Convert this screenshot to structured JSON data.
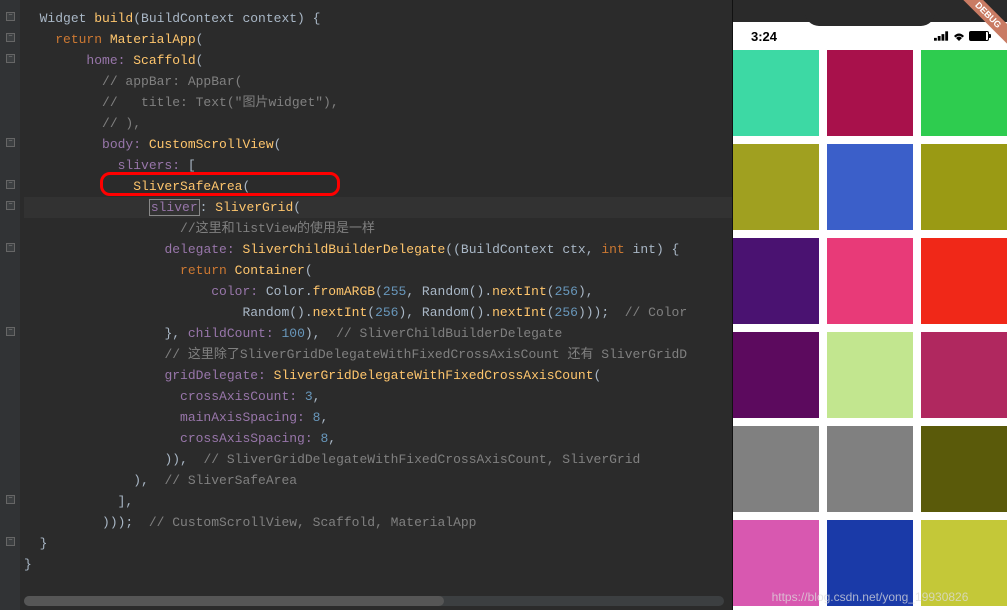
{
  "editor": {
    "lines": [
      {
        "indent": 1,
        "tokens": [
          [
            "Widget ",
            "type"
          ],
          [
            "build",
            "build"
          ],
          [
            "(BuildContext context) {",
            "punc"
          ]
        ]
      },
      {
        "indent": 2,
        "tokens": [
          [
            "return ",
            "return"
          ],
          [
            "MaterialApp",
            "widget"
          ],
          [
            "(",
            "punc"
          ]
        ]
      },
      {
        "indent": 4,
        "tokens": [
          [
            "home: ",
            "prop"
          ],
          [
            "Scaffold",
            "widget"
          ],
          [
            "(",
            "punc"
          ]
        ]
      },
      {
        "indent": 5,
        "tokens": [
          [
            "// appBar: AppBar(",
            "comment"
          ]
        ]
      },
      {
        "indent": 5,
        "tokens": [
          [
            "//   title: Text(\"图片widget\"),",
            "comment"
          ]
        ]
      },
      {
        "indent": 5,
        "tokens": [
          [
            "// ),",
            "comment"
          ]
        ]
      },
      {
        "indent": 5,
        "tokens": [
          [
            "body: ",
            "prop"
          ],
          [
            "CustomScrollView",
            "widget"
          ],
          [
            "(",
            "punc"
          ]
        ]
      },
      {
        "indent": 6,
        "tokens": [
          [
            "slivers: ",
            "prop"
          ],
          [
            "[",
            "punc"
          ]
        ]
      },
      {
        "indent": 7,
        "tokens": [
          [
            "SliverSafeArea",
            "widget"
          ],
          [
            "(",
            "punc"
          ]
        ],
        "redbox": true
      },
      {
        "indent": 8,
        "tokens": [
          [
            "sliver",
            "prop-caret"
          ],
          [
            ": ",
            "punc"
          ],
          [
            "SliverGrid",
            "widget"
          ],
          [
            "(",
            "punc"
          ]
        ],
        "highlight": true
      },
      {
        "indent": 10,
        "tokens": [
          [
            "//这里和listView的使用是一样",
            "comment"
          ]
        ]
      },
      {
        "indent": 9,
        "tokens": [
          [
            "delegate: ",
            "prop"
          ],
          [
            "SliverChildBuilderDelegate",
            "widget"
          ],
          [
            "((BuildContext ctx, ",
            "punc"
          ],
          [
            "int",
            "return"
          ],
          [
            " int) {",
            "punc"
          ]
        ]
      },
      {
        "indent": 10,
        "tokens": [
          [
            "return ",
            "return"
          ],
          [
            "Container",
            "widget"
          ],
          [
            "(",
            "punc"
          ]
        ]
      },
      {
        "indent": 12,
        "tokens": [
          [
            "color: ",
            "prop"
          ],
          [
            "Color",
            "type"
          ],
          [
            ".",
            "punc"
          ],
          [
            "fromARGB",
            "method"
          ],
          [
            "(",
            "punc"
          ],
          [
            "255",
            "num"
          ],
          [
            ", ",
            "punc"
          ],
          [
            "Random",
            "type"
          ],
          [
            "().",
            "punc"
          ],
          [
            "nextInt",
            "method"
          ],
          [
            "(",
            "punc"
          ],
          [
            "256",
            "num"
          ],
          [
            "),",
            "punc"
          ]
        ]
      },
      {
        "indent": 14,
        "tokens": [
          [
            "Random",
            "type"
          ],
          [
            "().",
            "punc"
          ],
          [
            "nextInt",
            "method"
          ],
          [
            "(",
            "punc"
          ],
          [
            "256",
            "num"
          ],
          [
            "), ",
            "punc"
          ],
          [
            "Random",
            "type"
          ],
          [
            "().",
            "punc"
          ],
          [
            "nextInt",
            "method"
          ],
          [
            "(",
            "punc"
          ],
          [
            "256",
            "num"
          ],
          [
            ")));  ",
            "punc"
          ],
          [
            "// Color",
            "comment"
          ]
        ]
      },
      {
        "indent": 9,
        "tokens": [
          [
            "}, ",
            "punc"
          ],
          [
            "childCount: ",
            "prop"
          ],
          [
            "100",
            "num"
          ],
          [
            "),  ",
            "punc"
          ],
          [
            "// SliverChildBuilderDelegate",
            "comment"
          ]
        ]
      },
      {
        "indent": 9,
        "tokens": [
          [
            "// 这里除了SliverGridDelegateWithFixedCrossAxisCount 还有 SliverGridD",
            "comment"
          ]
        ]
      },
      {
        "indent": 9,
        "tokens": [
          [
            "gridDelegate: ",
            "prop"
          ],
          [
            "SliverGridDelegateWithFixedCrossAxisCount",
            "widget"
          ],
          [
            "(",
            "punc"
          ]
        ]
      },
      {
        "indent": 10,
        "tokens": [
          [
            "crossAxisCount: ",
            "prop"
          ],
          [
            "3",
            "num"
          ],
          [
            ",",
            "punc"
          ]
        ]
      },
      {
        "indent": 10,
        "tokens": [
          [
            "mainAxisSpacing: ",
            "prop"
          ],
          [
            "8",
            "num"
          ],
          [
            ",",
            "punc"
          ]
        ]
      },
      {
        "indent": 10,
        "tokens": [
          [
            "crossAxisSpacing: ",
            "prop"
          ],
          [
            "8",
            "num"
          ],
          [
            ",",
            "punc"
          ]
        ]
      },
      {
        "indent": 9,
        "tokens": [
          [
            "))",
            "punc"
          ],
          [
            ",  ",
            "punc"
          ],
          [
            "// SliverGridDelegateWithFixedCrossAxisCount, SliverGrid",
            "comment"
          ]
        ]
      },
      {
        "indent": 7,
        "tokens": [
          "),  ",
          "punc",
          "// SliverSafeArea",
          "comment"
        ],
        "tokens2": [
          [
            "),  ",
            "punc"
          ],
          [
            "// SliverSafeArea",
            "comment"
          ]
        ]
      },
      {
        "indent": 6,
        "tokens": [
          [
            "],",
            "punc"
          ]
        ]
      },
      {
        "indent": 5,
        "tokens": [
          [
            ")));  ",
            "punc"
          ],
          [
            "// CustomScrollView, Scaffold, MaterialApp",
            "comment"
          ]
        ]
      },
      {
        "indent": 1,
        "tokens": [
          [
            "}",
            "punc"
          ]
        ]
      },
      {
        "indent": 0,
        "tokens": [
          [
            "}",
            "punc"
          ]
        ]
      }
    ],
    "fold_positions": [
      12,
      33,
      54,
      138,
      180,
      201,
      243,
      327,
      495,
      537
    ]
  },
  "phone": {
    "time": "3:24",
    "debug_label": "DEBUG",
    "watermark": "https://blog.csdn.net/yong_19930826",
    "grid_colors": [
      "#3dd9a4",
      "#a8114b",
      "#2ecc4f",
      "#a0a020",
      "#3b5fc9",
      "#9a9a14",
      "#4a1271",
      "#e83a78",
      "#f02818",
      "#5c0a5e",
      "#c2e68f",
      "#b0285f",
      "#808080",
      "#808080",
      "#5a5a0a",
      "#d858b0",
      "#1a3aa8",
      "#c4c838"
    ]
  }
}
